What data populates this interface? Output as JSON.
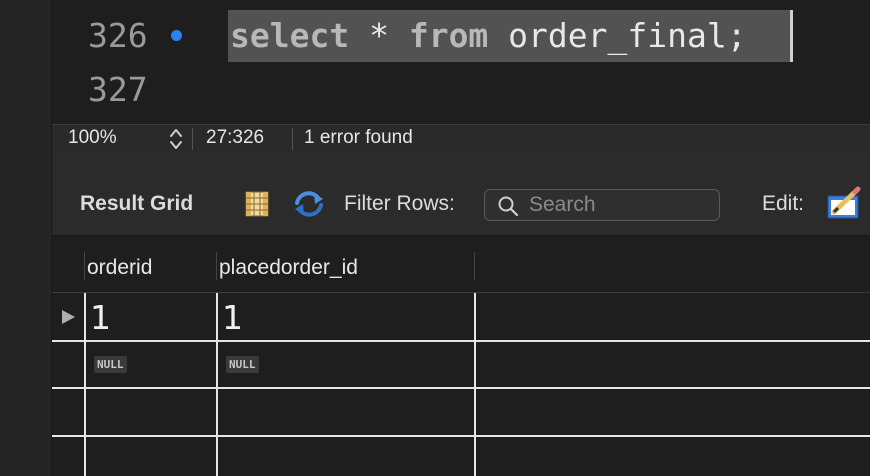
{
  "editor": {
    "lines": [
      {
        "number": "326",
        "keyword1": "select",
        "symbol": " * ",
        "keyword2": "from",
        "rest": " order_final;"
      },
      {
        "number": "327"
      }
    ]
  },
  "status_bar": {
    "zoom": "100%",
    "cursor_position": "27:326",
    "errors": "1 error found"
  },
  "toolbar": {
    "result_grid_label": "Result Grid",
    "filter_rows_label": "Filter Rows:",
    "search_placeholder": "Search",
    "edit_label": "Edit:"
  },
  "grid": {
    "columns": [
      "orderid",
      "placedorder_id"
    ],
    "rows": [
      [
        "1",
        "1"
      ],
      [
        "NULL",
        "NULL"
      ]
    ]
  },
  "colors": {
    "accent_blue": "#2e7ff1",
    "selection": "#525252",
    "editor_bg": "#1e1e1e"
  }
}
